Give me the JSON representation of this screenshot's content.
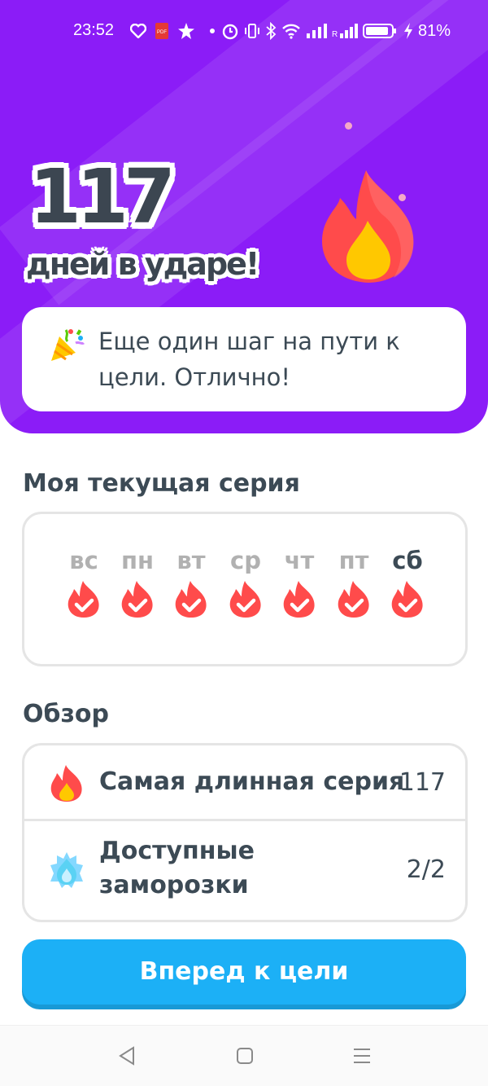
{
  "status_bar": {
    "time": "23:52",
    "battery": "81%"
  },
  "header": {
    "streak_count": "117",
    "streak_caption": "дней в ударе!",
    "message": "Еще один шаг на пути к цели. Отлично!"
  },
  "current_streak": {
    "title": "Моя текущая серия",
    "days": [
      {
        "label": "вс",
        "completed": true,
        "today": false
      },
      {
        "label": "пн",
        "completed": true,
        "today": false
      },
      {
        "label": "вт",
        "completed": true,
        "today": false
      },
      {
        "label": "ср",
        "completed": true,
        "today": false
      },
      {
        "label": "чт",
        "completed": true,
        "today": false
      },
      {
        "label": "пт",
        "completed": true,
        "today": false
      },
      {
        "label": "сб",
        "completed": true,
        "today": true
      }
    ]
  },
  "overview": {
    "title": "Обзор",
    "longest_label": "Самая длинная серия",
    "longest_value": "117",
    "freezes_label": "Доступные заморозки",
    "freezes_value": "2/2"
  },
  "cta": {
    "label": "Вперед к цели"
  },
  "colors": {
    "hero": "#8b1cf7",
    "flame": "#ff4b4b",
    "flame_core": "#ffc800",
    "cta": "#1cb0f6",
    "freeze": "#5ad2f4"
  },
  "icons": {
    "status_left": [
      "heart-icon",
      "pdf-icon",
      "star-icon",
      "dot-icon"
    ],
    "status_right": [
      "alarm-icon",
      "vibrate-icon",
      "bluetooth-icon",
      "wifi-icon",
      "signal-icon",
      "battery-icon"
    ],
    "message_icon": "party-popper-icon",
    "nav": [
      "back-icon",
      "home-icon",
      "menu-icon"
    ]
  }
}
